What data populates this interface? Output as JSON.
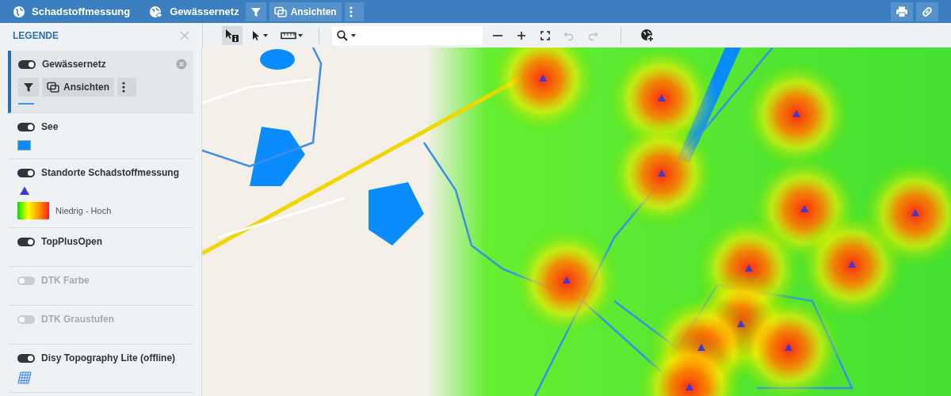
{
  "topbar": {
    "app_title": "Schadstoffmessung",
    "layer_title": "Gewässernetz",
    "buttons": [
      {
        "kind": "filter"
      },
      {
        "kind": "views",
        "label": "Ansichten"
      },
      {
        "kind": "more"
      }
    ],
    "right_buttons": [
      {
        "kind": "print"
      },
      {
        "kind": "link"
      }
    ]
  },
  "legend": {
    "title": "LEGENDE",
    "layers": [
      {
        "name": "Gewässernetz",
        "on": true,
        "selected": true,
        "actions": [
          {
            "kind": "filter"
          },
          {
            "kind": "views",
            "label": "Ansichten"
          },
          {
            "kind": "more"
          }
        ],
        "symbols": [
          {
            "kind": "line",
            "color": "#3399ff"
          }
        ]
      },
      {
        "name": "See",
        "on": true,
        "selected": false,
        "symbols": [
          {
            "kind": "fill",
            "color": "#0a8cff"
          }
        ]
      },
      {
        "name": "Standorte Schadstoffmessung",
        "on": true,
        "selected": false,
        "symbols": [
          {
            "kind": "marker",
            "color": "#3a3ad6"
          },
          {
            "kind": "gradient",
            "label": "Niedrig - Hoch"
          }
        ]
      },
      {
        "name": "TopPlusOpen",
        "on": true,
        "selected": false
      },
      {
        "name": "DTK Farbe",
        "on": false,
        "selected": false
      },
      {
        "name": "DTK Graustufen",
        "on": false,
        "selected": false
      },
      {
        "name": "Disy Topography Lite (offline)",
        "on": true,
        "selected": false,
        "symbols": [
          {
            "kind": "raster"
          }
        ]
      }
    ]
  },
  "toolbar": {
    "tools": [
      {
        "kind": "info",
        "selected": true,
        "caret": false
      },
      {
        "kind": "select",
        "selected": false,
        "caret": true
      },
      {
        "kind": "measure",
        "selected": false,
        "caret": true
      }
    ],
    "actions": [
      {
        "kind": "zoom-out",
        "disabled": false
      },
      {
        "kind": "zoom-in",
        "disabled": false
      },
      {
        "kind": "fullscreen",
        "disabled": false
      },
      {
        "kind": "undo",
        "disabled": true
      },
      {
        "kind": "redo",
        "disabled": true
      }
    ]
  }
}
